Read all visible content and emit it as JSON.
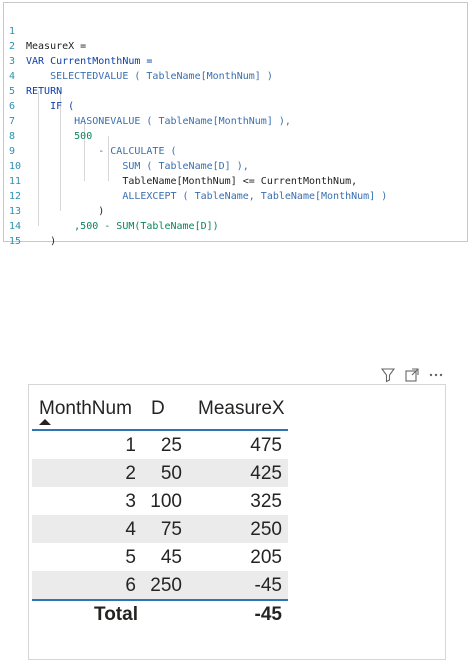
{
  "code": {
    "lines": [
      {
        "no": "1",
        "text": "MeasureX ="
      },
      {
        "no": "2",
        "text": "VAR CurrentMonthNum ="
      },
      {
        "no": "3",
        "text": "    SELECTEDVALUE ( TableName[MonthNum] )"
      },
      {
        "no": "4",
        "text": "RETURN"
      },
      {
        "no": "5",
        "text": "    IF ("
      },
      {
        "no": "6",
        "text": "        HASONEVALUE ( TableName[MonthNum] ),"
      },
      {
        "no": "7",
        "text": "        500"
      },
      {
        "no": "8",
        "text": "            - CALCULATE ("
      },
      {
        "no": "9",
        "text": "                SUM ( TableName[D] ),"
      },
      {
        "no": "10",
        "text": "                TableName[MonthNum] <= CurrentMonthNum,"
      },
      {
        "no": "11",
        "text": "                ALLEXCEPT ( TableName, TableName[MonthNum] )"
      },
      {
        "no": "12",
        "text": "            )"
      },
      {
        "no": "13",
        "text": "        ,500 - SUM(TableName[D])"
      },
      {
        "no": "14",
        "text": "    )"
      },
      {
        "no": "15",
        "text": ""
      }
    ]
  },
  "visual_header": {
    "icons": [
      "filter-icon",
      "focus-mode-icon",
      "more-options-icon"
    ]
  },
  "table": {
    "columns": [
      "MonthNum",
      "D",
      "MeasureX"
    ],
    "sort_indicator": "sort-ascending-icon",
    "rows": [
      {
        "month": "1",
        "d": "25",
        "measure": "475"
      },
      {
        "month": "2",
        "d": "50",
        "measure": "425"
      },
      {
        "month": "3",
        "d": "100",
        "measure": "325"
      },
      {
        "month": "4",
        "d": "75",
        "measure": "250"
      },
      {
        "month": "5",
        "d": "45",
        "measure": "205"
      },
      {
        "month": "6",
        "d": "250",
        "measure": "-45"
      }
    ],
    "total": {
      "label": "Total",
      "measure": "-45"
    }
  },
  "colors": {
    "accent_line": "#2e75b6",
    "row_alt": "#ebebeb",
    "line_number": "#2b91af"
  }
}
